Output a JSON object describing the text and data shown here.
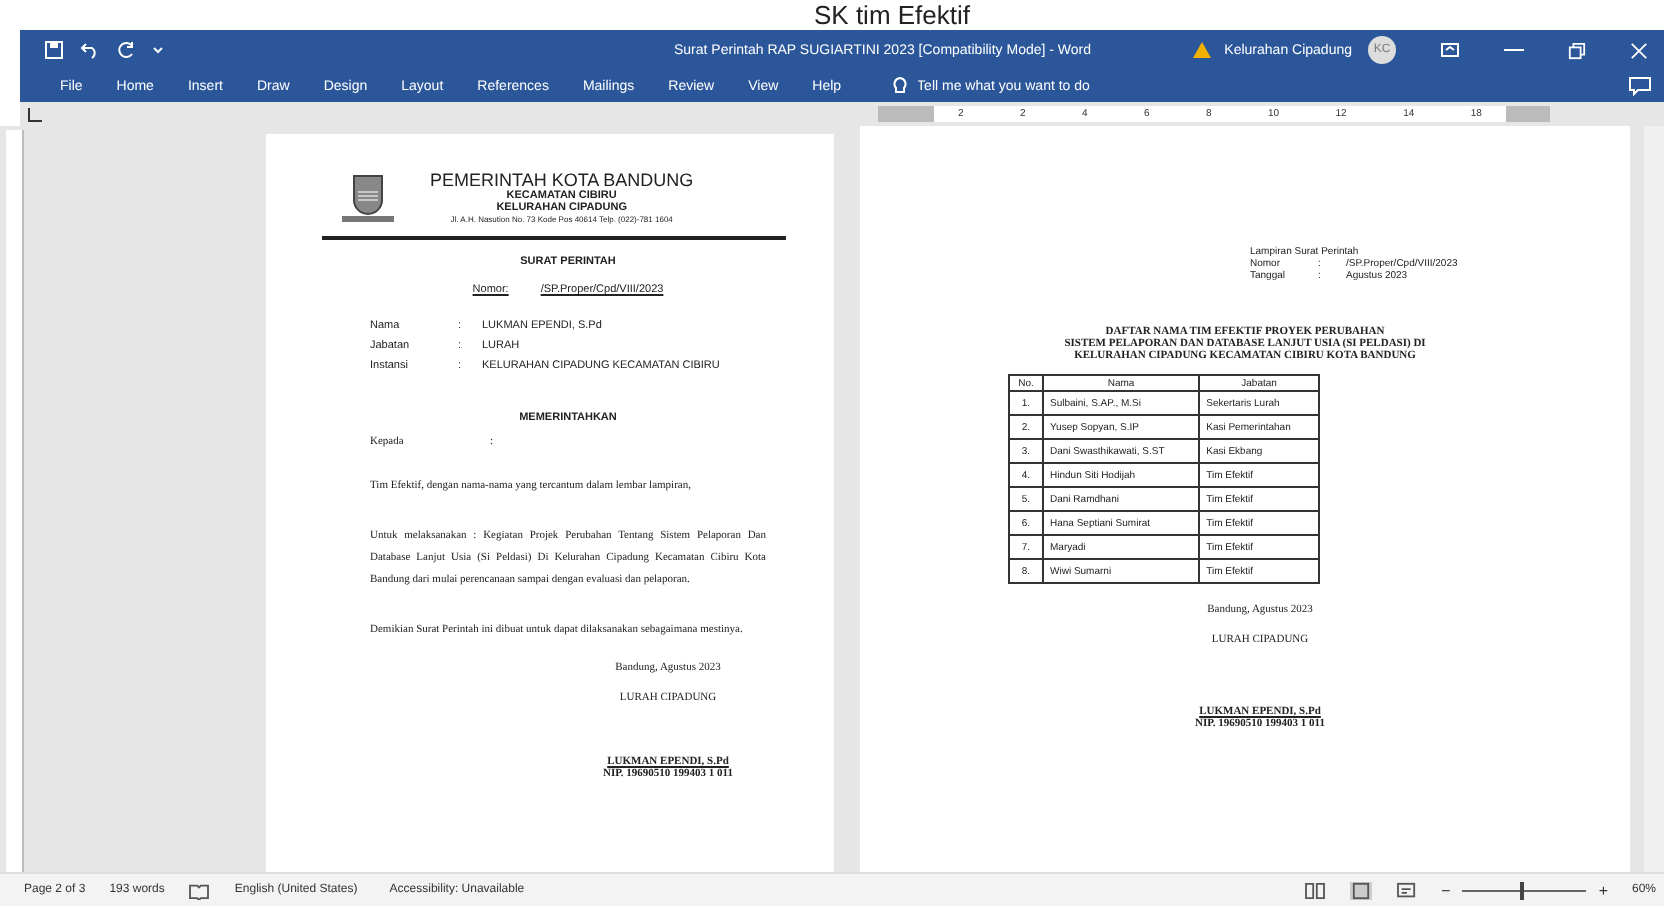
{
  "caption": "SK tim Efektif",
  "window": {
    "title": "Surat Perintah RAP SUGIARTINI 2023 [Compatibility Mode]  -  Word",
    "account": "Kelurahan Cipadung",
    "avatar": "KC"
  },
  "menu": [
    {
      "label": "File"
    },
    {
      "label": "Home"
    },
    {
      "label": "Insert"
    },
    {
      "label": "Draw"
    },
    {
      "label": "Design"
    },
    {
      "label": "Layout"
    },
    {
      "label": "References"
    },
    {
      "label": "Mailings"
    },
    {
      "label": "Review"
    },
    {
      "label": "View"
    },
    {
      "label": "Help"
    }
  ],
  "tell_me": {
    "placeholder": "Tell me what you want to do"
  },
  "ruler": [
    "2",
    "2",
    "4",
    "6",
    "8",
    "10",
    "12",
    "14",
    "18"
  ],
  "page_left": {
    "letterhead": [
      "PEMERINTAH KOTA BANDUNG",
      "KECAMATAN CIBIRU",
      "KELURAHAN CIPADUNG",
      "Jl. A.H. Nasution No. 73 Kode Pos 40614 Telp. (022)-781 1604"
    ],
    "title": "SURAT PERINTAH",
    "number_label": "Nomor:",
    "number": "/SP.Proper/Cpd/VIII/2023",
    "fields": [
      {
        "label": "Nama",
        "colon": ":",
        "value": "LUKMAN EPENDI, S.Pd"
      },
      {
        "label": "Jabatan",
        "colon": ":",
        "value": "LURAH"
      },
      {
        "label": "Instansi",
        "colon": ":",
        "value": "KELURAHAN CIPADUNG KECAMATAN CIBIRU"
      }
    ],
    "order": "MEMERINTAHKAN",
    "to_label": "Kepada",
    "to_colon": ":",
    "paragraphs": [
      "Tim Efektif, dengan nama-nama yang tercantum dalam lembar lampiran,",
      "Untuk melaksanakan : Kegiatan Projek Perubahan Tentang Sistem Pelaporan Dan Database Lanjut Usia (Si Peldasi) Di Kelurahan Cipadung Kecamatan Cibiru Kota Bandung dari mulai perencanaan sampai dengan evaluasi dan pelaporan.",
      "Demikian Surat Perintah ini dibuat untuk dapat dilaksanakan sebagaimana mestinya."
    ],
    "place_date": "Bandung,   Agustus 2023",
    "position": "LURAH CIPADUNG",
    "signer": "LUKMAN EPENDI, S.Pd",
    "nip": "NIP. 19690510 199403 1 011"
  },
  "page_right": {
    "attachment": [
      {
        "label": "Lampiran Surat Perintah"
      },
      {
        "label": "Nomor",
        "colon": ":",
        "value": "/SP.Proper/Cpd/VIII/2023"
      },
      {
        "label": "Tanggal",
        "colon": ":",
        "value": "Agustus 2023"
      }
    ],
    "title": [
      "DAFTAR NAMA TIM EFEKTIF PROYEK PERUBAHAN",
      "SISTEM PELAPORAN DAN DATABASE LANJUT USIA (SI PELDASI) DI",
      "KELURAHAN CIPADUNG KECAMATAN CIBIRU KOTA BANDUNG"
    ],
    "table": {
      "columns": [
        "No.",
        "Nama",
        "Jabatan"
      ],
      "rows": [
        [
          "1.",
          "Sulbaini, S.AP., M.Si",
          "Sekertaris Lurah"
        ],
        [
          "2.",
          "Yusep Sopyan, S.IP",
          "Kasi Pemerintahan"
        ],
        [
          "3.",
          "Dani Swasthikawati, S.ST",
          "Kasi Ekbang"
        ],
        [
          "4.",
          "Hindun Siti Hodijah",
          "Tim Efektif"
        ],
        [
          "5.",
          "Dani Ramdhani",
          "Tim Efektif"
        ],
        [
          "6.",
          "Hana Septiani Sumirat",
          "Tim Efektif"
        ],
        [
          "7.",
          "Maryadi",
          "Tim Efektif"
        ],
        [
          "8.",
          "Wiwi Sumarni",
          "Tim Efektif"
        ]
      ]
    },
    "place_date": "Bandung,   Agustus 2023",
    "position": "LURAH CIPADUNG",
    "signer": "LUKMAN EPENDI, S.Pd",
    "nip": "NIP. 19690510 199403 1 011"
  },
  "status_bar": {
    "page": "Page 2 of 3",
    "words": "193 words",
    "language": "English (United States)",
    "accessibility": "Accessibility: Unavailable",
    "zoom": {
      "minus": "−",
      "plus": "+",
      "level": 0.48,
      "reading": "60%"
    }
  }
}
